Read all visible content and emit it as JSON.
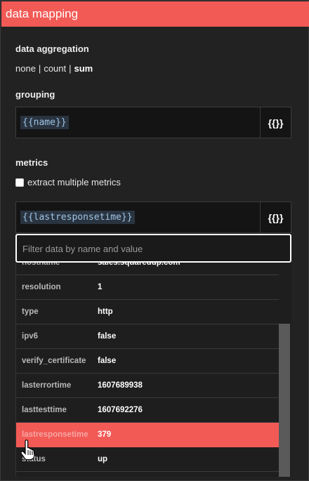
{
  "panel": {
    "title": "data mapping"
  },
  "aggregation": {
    "label": "data aggregation",
    "options": [
      "none",
      "count",
      "sum"
    ],
    "separator": "|",
    "selected": "sum"
  },
  "grouping": {
    "label": "grouping",
    "value": "{{name}}",
    "picker_label": "{{}}"
  },
  "metrics": {
    "label": "metrics",
    "checkbox_label": "extract multiple metrics",
    "checkbox_checked": false,
    "value": "{{lastresponsetime}}",
    "picker_label": "{{}}"
  },
  "filter": {
    "placeholder": "Filter data by name and value",
    "value": ""
  },
  "properties": [
    {
      "key": "hostname",
      "value": "sales.squaredup.com"
    },
    {
      "key": "resolution",
      "value": "1"
    },
    {
      "key": "type",
      "value": "http"
    },
    {
      "key": "ipv6",
      "value": "false"
    },
    {
      "key": "verify_certificate",
      "value": "false"
    },
    {
      "key": "lasterrortime",
      "value": "1607689938"
    },
    {
      "key": "lasttesttime",
      "value": "1607692276"
    },
    {
      "key": "lastresponsetime",
      "value": "379"
    },
    {
      "key": "status",
      "value": "up"
    }
  ],
  "highlighted_property": "lastresponsetime",
  "colors": {
    "accent": "#f25a56",
    "background": "#222222",
    "field_background": "#141414",
    "token_text": "#9ec5e6"
  },
  "icons": {
    "cursor": "hand-pointer-icon"
  }
}
